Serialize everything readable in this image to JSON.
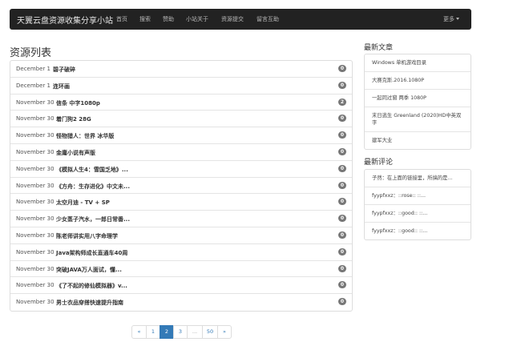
{
  "navbar": {
    "brand": "天翼云盘资源收集分享小站",
    "items": [
      "首页",
      "搜索",
      "赞助",
      "小站关于",
      "资源提交",
      "留言互助"
    ],
    "more": "更多"
  },
  "main": {
    "title": "资源列表",
    "rows": [
      {
        "date": "December 1",
        "title": "碧孑破碎",
        "count": "0"
      },
      {
        "date": "December 1",
        "title": "连环画",
        "count": "0"
      },
      {
        "date": "November 30",
        "title": "信条 中字1080p",
        "count": "2"
      },
      {
        "date": "November 30",
        "title": "着门狗2 28G",
        "count": "0"
      },
      {
        "date": "November 30",
        "title": "怪物猎人：世界 冰华版",
        "count": "0"
      },
      {
        "date": "November 30",
        "title": "金庸小说有声版",
        "count": "0"
      },
      {
        "date": "November 30",
        "title": "《模拟人生4：雪国乏地》...",
        "count": "0"
      },
      {
        "date": "November 30",
        "title": "《方舟：生存进化》中文未...",
        "count": "0"
      },
      {
        "date": "November 30",
        "title": "太空月迪 - TV + SP",
        "count": "0"
      },
      {
        "date": "November 30",
        "title": "少女蒸子汽水，一郎日常番...",
        "count": "0"
      },
      {
        "date": "November 30",
        "title": "陈老师讲实用八字命理学",
        "count": "0"
      },
      {
        "date": "November 30",
        "title": "Java架构师成长直通车40周",
        "count": "0"
      },
      {
        "date": "November 30",
        "title": "突破JAVA万人面试，懂...",
        "count": "0"
      },
      {
        "date": "November 30",
        "title": "《了不起的修仙模拟器》v...",
        "count": "0"
      },
      {
        "date": "November 30",
        "title": "男士衣品穿搭快速提升指南",
        "count": "0"
      }
    ]
  },
  "sidebar": {
    "latest_heading": "最新文章",
    "latest": [
      "Windows 单机游戏目录",
      "大赛克斯.2016.1080P",
      "一起同过窗 两季 1080P",
      "末日逃生 Greenland (2020)HD中英双字",
      "建军大业"
    ],
    "comments_heading": "最新评论",
    "comments": [
      "子然：在上面的链接里，所搞的是...",
      "fyypfxxz：::rose:: ::...",
      "fyypfxxz：::good:: ::...",
      "fyypfxxz：::good:: ::..."
    ]
  },
  "pagination": {
    "prev": "«",
    "pages": [
      "1",
      "2",
      "3",
      "...",
      "50"
    ],
    "next": "»",
    "active": "2"
  },
  "colors": {
    "navbar_bg": "#222222",
    "accent": "#337ab7",
    "badge": "#777777"
  }
}
